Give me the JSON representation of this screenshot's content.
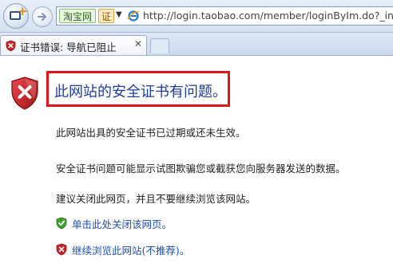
{
  "address_bar": {
    "site_badge": "淘宝网",
    "cert_badge": "证",
    "dropdown_arrow": "▼",
    "url": "http://login.taobao.com/member/loginByIm.do?_input_"
  },
  "tab": {
    "title": "证书错误: 导航已阻止",
    "close": "✕"
  },
  "content": {
    "heading": "此网站的安全证书有问题。",
    "paragraphs": [
      "此网站出具的安全证书已过期或还未生效。",
      "安全证书问题可能显示试图欺骗您或截获您向服务器发送的数据。",
      "建议关闭此网页，并且不要继续浏览该网站。"
    ],
    "actions": {
      "close_page": "单击此处关闭该网页。",
      "continue": "继续浏览此网站(不推荐)。"
    }
  },
  "icons": {
    "error_shield": "error-shield-icon",
    "ok_shield": "green-shield-check-icon",
    "warn_shield": "red-shield-x-icon",
    "ie": "ie-icon"
  },
  "colors": {
    "heading": "#1f3d99",
    "link": "#1f4fa8",
    "highlight_box": "#e0141a",
    "error_shield": "#c6262b"
  }
}
